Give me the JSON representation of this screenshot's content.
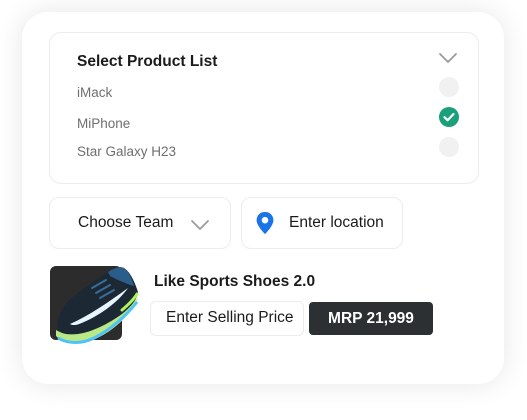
{
  "product_list": {
    "title": "Select Product List",
    "items": [
      {
        "label": "iMack",
        "selected": false
      },
      {
        "label": "MiPhone",
        "selected": true
      },
      {
        "label": "Star Galaxy H23",
        "selected": false
      }
    ],
    "expand_icon": "chevron-down-icon"
  },
  "team_select": {
    "label": "Choose Team",
    "icon": "chevron-down-icon"
  },
  "location_input": {
    "label": "Enter location",
    "icon": "map-pin-icon"
  },
  "product": {
    "name": "Like Sports Shoes 2.0",
    "image_icon": "sneaker-image",
    "price_placeholder": "Enter Selling Price",
    "mrp": "MRP 21,999"
  },
  "colors": {
    "accent_check": "#1aa07a",
    "pin_blue": "#1a73e8",
    "badge_dark": "#2c3032"
  }
}
